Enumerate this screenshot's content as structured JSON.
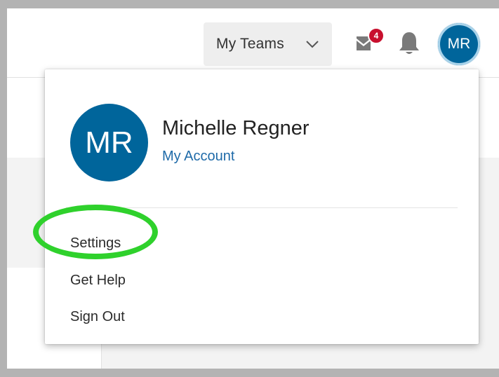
{
  "header": {
    "teams_label": "My Teams",
    "mail_badge_count": "4",
    "avatar_initials": "MR"
  },
  "profile_menu": {
    "avatar_initials": "MR",
    "user_name": "Michelle Regner",
    "account_link": "My Account",
    "items": [
      {
        "label": "Settings"
      },
      {
        "label": "Get Help"
      },
      {
        "label": "Sign Out"
      }
    ]
  },
  "annotation": {
    "highlight_color": "#2fd12c",
    "highlighted_item": "Settings"
  },
  "colors": {
    "brand_blue": "#00659b",
    "link_blue": "#1e6aa8",
    "badge_red": "#c8102e"
  },
  "icons": {
    "teams_dropdown": "chevron-down-icon",
    "mail": "envelope-icon",
    "notifications": "bell-icon"
  }
}
